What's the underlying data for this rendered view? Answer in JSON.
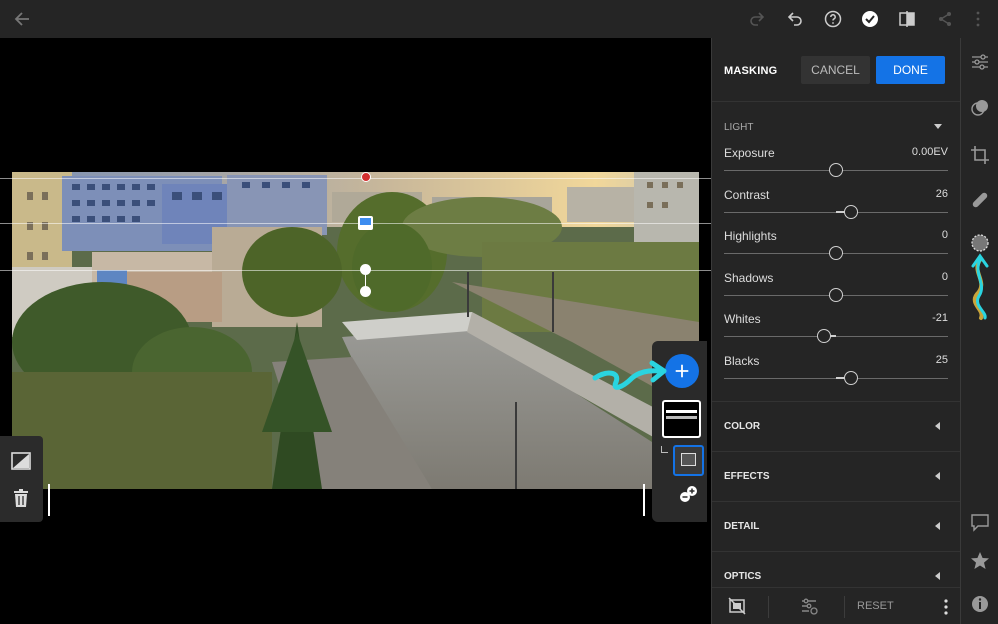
{
  "topbar": {
    "icons": [
      "back-arrow-icon",
      "redo-icon",
      "undo-icon",
      "help-icon",
      "checkmark-icon",
      "compare-icon",
      "share-icon",
      "more-icon"
    ]
  },
  "panel": {
    "title": "MASKING",
    "cancel_label": "CANCEL",
    "done_label": "DONE",
    "light_heading": "LIGHT",
    "sliders": [
      {
        "label": "Exposure",
        "value": "0.00EV",
        "level": 0.0
      },
      {
        "label": "Contrast",
        "value": "26",
        "level": 0.26
      },
      {
        "label": "Highlights",
        "value": "0",
        "level": 0.0
      },
      {
        "label": "Shadows",
        "value": "0",
        "level": 0.0
      },
      {
        "label": "Whites",
        "value": "-21",
        "level": -0.21
      },
      {
        "label": "Blacks",
        "value": "25",
        "level": 0.25
      }
    ],
    "sections": [
      "COLOR",
      "EFFECTS",
      "DETAIL",
      "OPTICS"
    ],
    "reset_label": "RESET"
  },
  "colors": {
    "accent": "#1473e6",
    "panel_bg": "#252525",
    "annotation": "#2ad4e0",
    "pin": "#d32f2f"
  }
}
